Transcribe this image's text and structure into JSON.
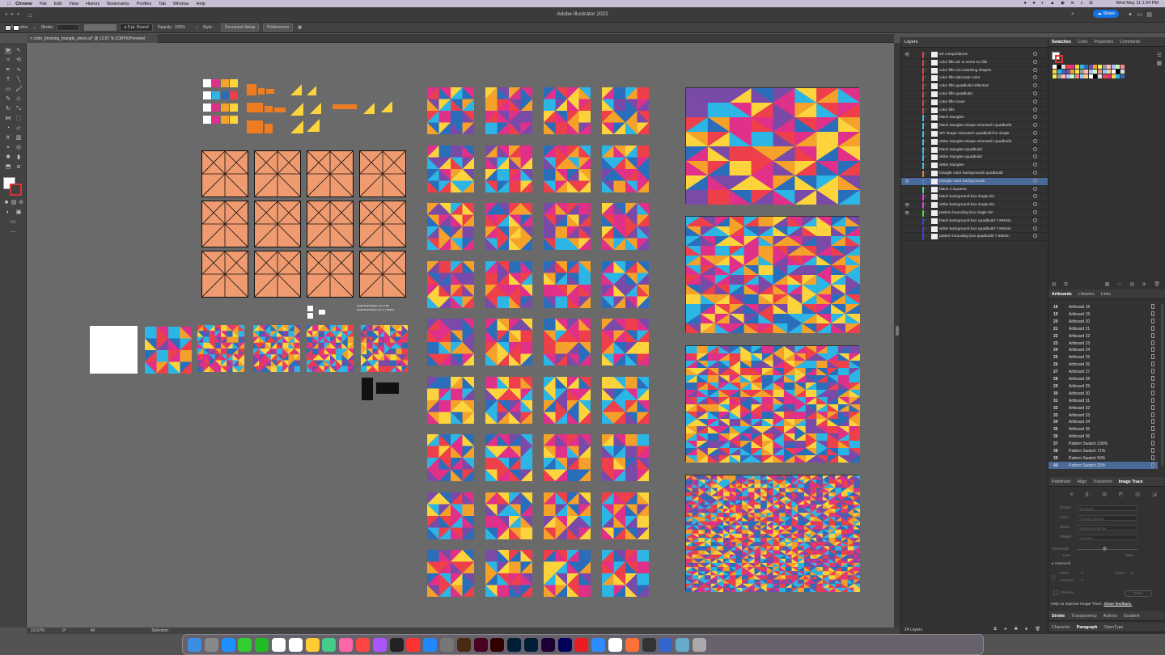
{
  "menubar": {
    "app": "Chrome",
    "items": [
      "File",
      "Edit",
      "View",
      "History",
      "Bookmarks",
      "Profiles",
      "Tab",
      "Window",
      "Help"
    ],
    "clock": "Wed May 11 1:24 PM"
  },
  "window": {
    "title": "Adobe Illustrator 2022",
    "share_label": "Share"
  },
  "control_bar": {
    "selection": "No Selection",
    "stroke_label": "Stroke:",
    "brush": "5 pt. Round",
    "opacity_label": "Opacity:",
    "opacity_value": "100%",
    "style_label": "Style:",
    "document_setup": "Document Setup",
    "preferences": "Preferences"
  },
  "document_tab": {
    "label": "color_blocking_triangle_slices.ai* @ 13.67 % (CMYK/Preview)"
  },
  "status_bar": {
    "zoom": "13.67%",
    "rotation": "0°",
    "artboard": "40",
    "mode": "Selection"
  },
  "canvas_text": {
    "note1": "Single Build Pattern box is 8in",
    "note2": "Quad Build Pattern box is 7.9554in"
  },
  "layers_panel": {
    "title": "Layers",
    "count": "24 Layers",
    "rows": [
      {
        "name": "art compositions",
        "color": "#e04040",
        "visible": true
      },
      {
        "name": "color fills alt. w some no fills",
        "color": "#e04040",
        "visible": false
      },
      {
        "name": "color fills not matching shapes",
        "color": "#e04040",
        "visible": false
      },
      {
        "name": "color fills alternate color",
        "color": "#e04040",
        "visible": false
      },
      {
        "name": "color fills quadbuild reflected",
        "color": "#e04040",
        "visible": false
      },
      {
        "name": "color fills quadbuild",
        "color": "#e04040",
        "visible": false
      },
      {
        "name": "color fills move",
        "color": "#e04040",
        "visible": false
      },
      {
        "name": "color fills",
        "color": "#e04040",
        "visible": false
      },
      {
        "name": "black triangles",
        "color": "#40c0e0",
        "visible": false
      },
      {
        "name": "black triangles shape mismatch quadbuild",
        "color": "#40c0e0",
        "visible": false
      },
      {
        "name": "WT shape mismatch quadbuild for single",
        "color": "#40c0e0",
        "visible": false
      },
      {
        "name": "white triangles shape mismatch quadbuild",
        "color": "#40c0e0",
        "visible": false
      },
      {
        "name": "black triangles quadbuild",
        "color": "#40c0e0",
        "visible": false
      },
      {
        "name": "white triangles quadbuild",
        "color": "#40c0e0",
        "visible": false
      },
      {
        "name": "white triangles",
        "color": "#40c0e0",
        "visible": false
      },
      {
        "name": "triangle color backgrounds quadbuild",
        "color": "#e08040",
        "visible": false
      },
      {
        "name": "triangle color backgrounds",
        "color": "#4080e0",
        "visible": true,
        "selected": true
      },
      {
        "name": "black 4 squares",
        "color": "#40e080",
        "visible": false
      },
      {
        "name": "black background box single 8in",
        "color": "#e040e0",
        "visible": false
      },
      {
        "name": "white background box single 8in",
        "color": "#e040e0",
        "visible": true
      },
      {
        "name": "pattern bounding box single 8in",
        "color": "#40e040",
        "visible": true
      },
      {
        "name": "black background box quadbuild 7.9554in",
        "color": "#4040e0",
        "visible": false
      },
      {
        "name": "white background box quadbuild 7.9554in",
        "color": "#4040e0",
        "visible": false
      },
      {
        "name": "pattern bounding box quadbuild 7.9554in",
        "color": "#4040e0",
        "visible": false
      }
    ]
  },
  "swatches_panel": {
    "tabs": [
      "Swatches",
      "Color",
      "Properties",
      "Comments"
    ]
  },
  "artboards_panel": {
    "tabs": [
      "Artboards",
      "Libraries",
      "Links"
    ],
    "rows": [
      {
        "num": "18",
        "name": "Artboard 18"
      },
      {
        "num": "19",
        "name": "Artboard 19"
      },
      {
        "num": "20",
        "name": "Artboard 20"
      },
      {
        "num": "21",
        "name": "Artboard 21"
      },
      {
        "num": "22",
        "name": "Artboard 22"
      },
      {
        "num": "23",
        "name": "Artboard 23"
      },
      {
        "num": "24",
        "name": "Artboard 24"
      },
      {
        "num": "25",
        "name": "Artboard 25"
      },
      {
        "num": "26",
        "name": "Artboard 26"
      },
      {
        "num": "27",
        "name": "Artboard 27"
      },
      {
        "num": "28",
        "name": "Artboard 28"
      },
      {
        "num": "29",
        "name": "Artboard 29"
      },
      {
        "num": "30",
        "name": "Artboard 30"
      },
      {
        "num": "31",
        "name": "Artboard 31"
      },
      {
        "num": "32",
        "name": "Artboard 32"
      },
      {
        "num": "33",
        "name": "Artboard 33"
      },
      {
        "num": "34",
        "name": "Artboard 34"
      },
      {
        "num": "35",
        "name": "Artboard 35"
      },
      {
        "num": "36",
        "name": "Artboard 36"
      },
      {
        "num": "37",
        "name": "Pattern Swatch 100%"
      },
      {
        "num": "38",
        "name": "Pattern Swatch 71%"
      },
      {
        "num": "39",
        "name": "Pattern Swatch 50%"
      },
      {
        "num": "40",
        "name": "Pattern Swatch 25%"
      }
    ]
  },
  "image_trace_panel": {
    "tabs": [
      "Pathfinder",
      "Align",
      "Transform",
      "Image Trace"
    ],
    "rows": [
      {
        "label": "Preset:",
        "value": "[Default]"
      },
      {
        "label": "View:",
        "value": "Tracing Result"
      },
      {
        "label": "Mode:",
        "value": "Black and White"
      },
      {
        "label": "Palette:",
        "value": "Limited"
      }
    ],
    "threshold_label": "Threshold:",
    "less": "Less",
    "more": "More",
    "advanced": "Advanced",
    "paths_label": "Paths:",
    "paths_value": "0",
    "colors_label": "Colors:",
    "colors_value": "0",
    "anchors_label": "Anchors:",
    "anchors_value": "0",
    "preview": "Preview",
    "trace": "Trace",
    "help_text": "Help us improve Image Trace.",
    "share_feedback": "Share feedback."
  },
  "bottom_tabs": {
    "row1": [
      "Stroke",
      "Transparency",
      "Actions",
      "Gradient"
    ],
    "row2": [
      "Character",
      "Paragraph",
      "OpenType"
    ]
  },
  "dock_icons": [
    "finder",
    "launchpad",
    "safari",
    "messages",
    "facetime",
    "calendar",
    "reminders",
    "notes",
    "maps",
    "photos",
    "music",
    "podcasts",
    "tv",
    "news",
    "app-store",
    "system-preferences",
    "bridge",
    "indesign",
    "illustrator",
    "photoshop",
    "lightroom",
    "rush",
    "premiere",
    "acrobat",
    "zoom",
    "chrome",
    "firefox",
    "calculator",
    "files",
    "downloads",
    "trash"
  ],
  "colors": {
    "pink": "#e0308a",
    "red": "#ee3f4a",
    "yellow": "#fdd43c",
    "cyan": "#2cb6e6",
    "blue": "#2a6ebb",
    "purple": "#7a4aa8",
    "orange": "#f5a12a",
    "salmon": "#f09a6f"
  }
}
